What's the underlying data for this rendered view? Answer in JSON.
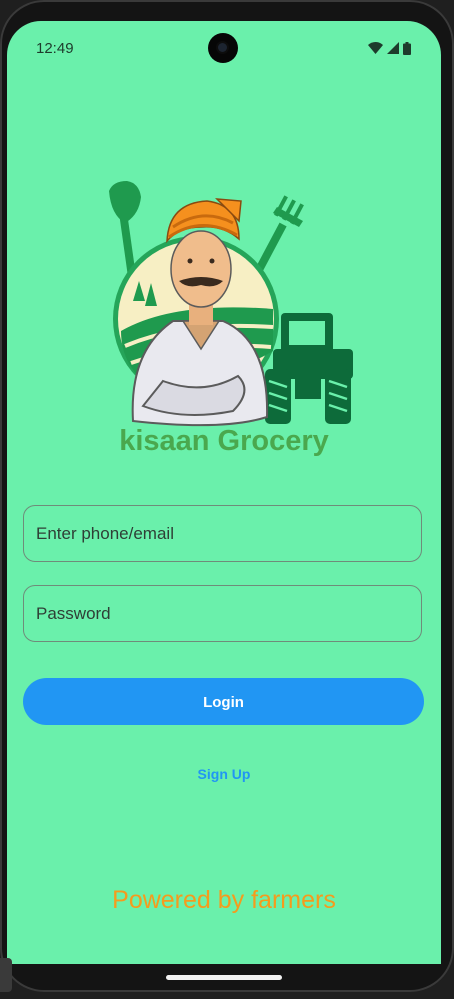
{
  "status_bar": {
    "time": "12:49",
    "icons": [
      "wifi-icon",
      "cell-signal-icon",
      "battery-icon"
    ]
  },
  "app": {
    "title": "kisaan Grocery",
    "logo_icon": "farmer-logo-icon"
  },
  "form": {
    "phone_email_placeholder": "Enter phone/email",
    "phone_email_value": "",
    "password_placeholder": "Password",
    "password_value": ""
  },
  "actions": {
    "login_label": "Login",
    "signup_label": "Sign Up"
  },
  "footer": {
    "powered_text": "Powered by farmers"
  },
  "colors": {
    "background": "#6af0ab",
    "title": "#4aa84e",
    "primary": "#2196f3",
    "footer_text": "#f59b1d"
  }
}
